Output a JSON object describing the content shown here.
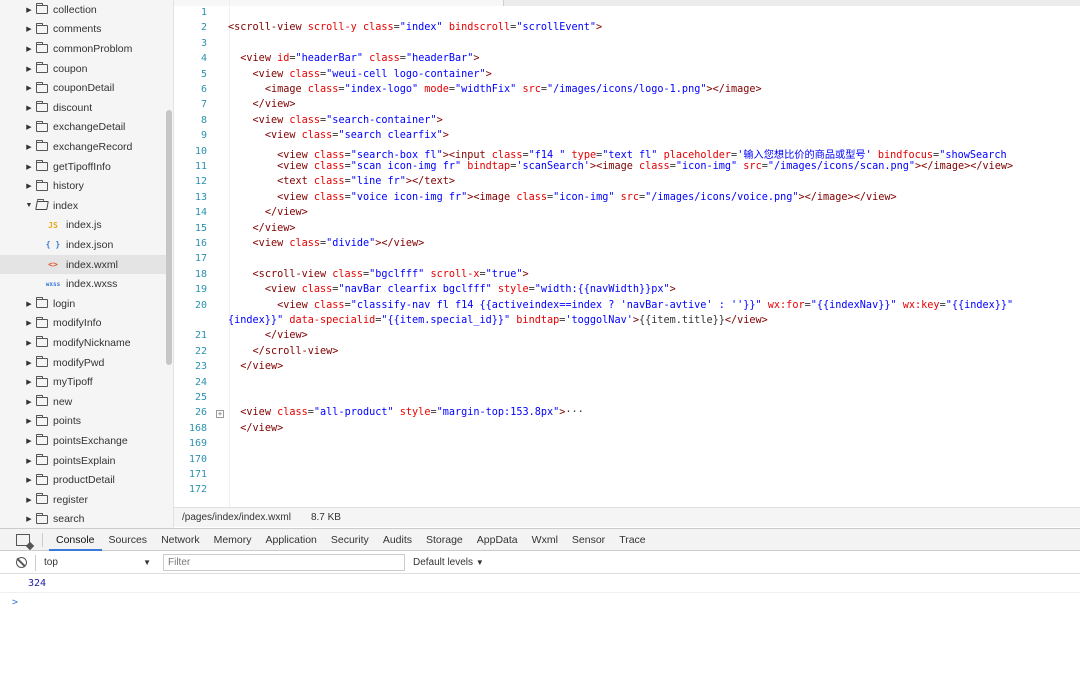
{
  "tree": {
    "items": [
      {
        "label": "collection",
        "type": "folder"
      },
      {
        "label": "comments",
        "type": "folder"
      },
      {
        "label": "commonProblom",
        "type": "folder"
      },
      {
        "label": "coupon",
        "type": "folder"
      },
      {
        "label": "couponDetail",
        "type": "folder"
      },
      {
        "label": "discount",
        "type": "folder"
      },
      {
        "label": "exchangeDetail",
        "type": "folder"
      },
      {
        "label": "exchangeRecord",
        "type": "folder"
      },
      {
        "label": "getTipoffInfo",
        "type": "folder"
      },
      {
        "label": "history",
        "type": "folder"
      },
      {
        "label": "index",
        "type": "folder-open"
      },
      {
        "label": "index.js",
        "type": "file",
        "badge": "JS",
        "badge_color": "#e6a817"
      },
      {
        "label": "index.json",
        "type": "file",
        "badge": "{ }",
        "badge_color": "#3b7bd4"
      },
      {
        "label": "index.wxml",
        "type": "file",
        "badge": "<>",
        "badge_color": "#e0532f",
        "selected": true
      },
      {
        "label": "index.wxss",
        "type": "file",
        "badge": "wxss",
        "badge_color": "#3b7bd4"
      },
      {
        "label": "login",
        "type": "folder"
      },
      {
        "label": "modifyInfo",
        "type": "folder"
      },
      {
        "label": "modifyNickname",
        "type": "folder"
      },
      {
        "label": "modifyPwd",
        "type": "folder"
      },
      {
        "label": "myTipoff",
        "type": "folder"
      },
      {
        "label": "new",
        "type": "folder"
      },
      {
        "label": "points",
        "type": "folder"
      },
      {
        "label": "pointsExchange",
        "type": "folder"
      },
      {
        "label": "pointsExplain",
        "type": "folder"
      },
      {
        "label": "productDetail",
        "type": "folder"
      },
      {
        "label": "register",
        "type": "folder"
      },
      {
        "label": "search",
        "type": "folder"
      }
    ]
  },
  "editor": {
    "lines": [
      {
        "num": "1",
        "tokens": []
      },
      {
        "num": "2",
        "tokens": [
          [
            "tag",
            "<scroll-view "
          ],
          [
            "attr",
            "scroll-y "
          ],
          [
            "attr",
            "class"
          ],
          [
            "pl",
            "="
          ],
          [
            "str",
            "\"index\" "
          ],
          [
            "attr",
            "bindscroll"
          ],
          [
            "pl",
            "="
          ],
          [
            "str",
            "\"scrollEvent\""
          ],
          [
            "tag",
            ">"
          ]
        ]
      },
      {
        "num": "3",
        "tokens": []
      },
      {
        "num": "4",
        "tokens": [
          [
            "pl",
            "  "
          ],
          [
            "tag",
            "<view "
          ],
          [
            "attr",
            "id"
          ],
          [
            "pl",
            "="
          ],
          [
            "str",
            "\"headerBar\" "
          ],
          [
            "attr",
            "class"
          ],
          [
            "pl",
            "="
          ],
          [
            "str",
            "\"headerBar\""
          ],
          [
            "tag",
            ">"
          ]
        ]
      },
      {
        "num": "5",
        "tokens": [
          [
            "pl",
            "    "
          ],
          [
            "tag",
            "<view "
          ],
          [
            "attr",
            "class"
          ],
          [
            "pl",
            "="
          ],
          [
            "str",
            "\"weui-cell logo-container\""
          ],
          [
            "tag",
            ">"
          ]
        ]
      },
      {
        "num": "6",
        "tokens": [
          [
            "pl",
            "      "
          ],
          [
            "tag",
            "<image "
          ],
          [
            "attr",
            "class"
          ],
          [
            "pl",
            "="
          ],
          [
            "str",
            "\"index-logo\" "
          ],
          [
            "attr",
            "mode"
          ],
          [
            "pl",
            "="
          ],
          [
            "str",
            "\"widthFix\" "
          ],
          [
            "attr",
            "src"
          ],
          [
            "pl",
            "="
          ],
          [
            "str",
            "\"/images/icons/logo-1.png\""
          ],
          [
            "tag",
            "></image>"
          ]
        ]
      },
      {
        "num": "7",
        "tokens": [
          [
            "pl",
            "    "
          ],
          [
            "tag",
            "</view>"
          ]
        ]
      },
      {
        "num": "8",
        "tokens": [
          [
            "pl",
            "    "
          ],
          [
            "tag",
            "<view "
          ],
          [
            "attr",
            "class"
          ],
          [
            "pl",
            "="
          ],
          [
            "str",
            "\"search-container\""
          ],
          [
            "tag",
            ">"
          ]
        ]
      },
      {
        "num": "9",
        "tokens": [
          [
            "pl",
            "      "
          ],
          [
            "tag",
            "<view "
          ],
          [
            "attr",
            "class"
          ],
          [
            "pl",
            "="
          ],
          [
            "str",
            "\"search clearfix\""
          ],
          [
            "tag",
            ">"
          ]
        ]
      },
      {
        "num": "10",
        "tokens": [
          [
            "pl",
            "        "
          ],
          [
            "tag",
            "<view "
          ],
          [
            "attr",
            "class"
          ],
          [
            "pl",
            "="
          ],
          [
            "str",
            "\"search-box fl\""
          ],
          [
            "tag",
            "><input "
          ],
          [
            "attr",
            "class"
          ],
          [
            "pl",
            "="
          ],
          [
            "str",
            "\"f14 \" "
          ],
          [
            "attr",
            "type"
          ],
          [
            "pl",
            "="
          ],
          [
            "str",
            "\"text fl\" "
          ],
          [
            "attr",
            "placeholder"
          ],
          [
            "pl",
            "="
          ],
          [
            "str",
            "'输入您想比价的商品或型号' "
          ],
          [
            "attr",
            "bindfocus"
          ],
          [
            "pl",
            "="
          ],
          [
            "str",
            "\"showSearch"
          ]
        ]
      },
      {
        "num": "11",
        "tokens": [
          [
            "pl",
            "        "
          ],
          [
            "tag",
            "<view "
          ],
          [
            "attr",
            "class"
          ],
          [
            "pl",
            "="
          ],
          [
            "str",
            "\"scan icon-img fr\" "
          ],
          [
            "attr",
            "bindtap"
          ],
          [
            "pl",
            "="
          ],
          [
            "str",
            "'scanSearch'"
          ],
          [
            "tag",
            "><image "
          ],
          [
            "attr",
            "class"
          ],
          [
            "pl",
            "="
          ],
          [
            "str",
            "\"icon-img\" "
          ],
          [
            "attr",
            "src"
          ],
          [
            "pl",
            "="
          ],
          [
            "str",
            "\"/images/icons/scan.png\""
          ],
          [
            "tag",
            "></image></view>"
          ]
        ]
      },
      {
        "num": "12",
        "tokens": [
          [
            "pl",
            "        "
          ],
          [
            "tag",
            "<text "
          ],
          [
            "attr",
            "class"
          ],
          [
            "pl",
            "="
          ],
          [
            "str",
            "\"line fr\""
          ],
          [
            "tag",
            "></text>"
          ]
        ]
      },
      {
        "num": "13",
        "tokens": [
          [
            "pl",
            "        "
          ],
          [
            "tag",
            "<view "
          ],
          [
            "attr",
            "class"
          ],
          [
            "pl",
            "="
          ],
          [
            "str",
            "\"voice icon-img fr\""
          ],
          [
            "tag",
            "><image "
          ],
          [
            "attr",
            "class"
          ],
          [
            "pl",
            "="
          ],
          [
            "str",
            "\"icon-img\" "
          ],
          [
            "attr",
            "src"
          ],
          [
            "pl",
            "="
          ],
          [
            "str",
            "\"/images/icons/voice.png\""
          ],
          [
            "tag",
            "></image></view>"
          ]
        ]
      },
      {
        "num": "14",
        "tokens": [
          [
            "pl",
            "      "
          ],
          [
            "tag",
            "</view>"
          ]
        ]
      },
      {
        "num": "15",
        "tokens": [
          [
            "pl",
            "    "
          ],
          [
            "tag",
            "</view>"
          ]
        ]
      },
      {
        "num": "16",
        "tokens": [
          [
            "pl",
            "    "
          ],
          [
            "tag",
            "<view "
          ],
          [
            "attr",
            "class"
          ],
          [
            "pl",
            "="
          ],
          [
            "str",
            "\"divide\""
          ],
          [
            "tag",
            "></view>"
          ]
        ]
      },
      {
        "num": "17",
        "tokens": []
      },
      {
        "num": "18",
        "tokens": [
          [
            "pl",
            "    "
          ],
          [
            "tag",
            "<scroll-view "
          ],
          [
            "attr",
            "class"
          ],
          [
            "pl",
            "="
          ],
          [
            "str",
            "\"bgclfff\" "
          ],
          [
            "attr",
            "scroll-x"
          ],
          [
            "pl",
            "="
          ],
          [
            "str",
            "\"true\""
          ],
          [
            "tag",
            ">"
          ]
        ]
      },
      {
        "num": "19",
        "tokens": [
          [
            "pl",
            "      "
          ],
          [
            "tag",
            "<view "
          ],
          [
            "attr",
            "class"
          ],
          [
            "pl",
            "="
          ],
          [
            "str",
            "\"navBar clearfix bgclfff\" "
          ],
          [
            "attr",
            "style"
          ],
          [
            "pl",
            "="
          ],
          [
            "str",
            "\"width:{{navWidth}}px\""
          ],
          [
            "tag",
            ">"
          ]
        ]
      },
      {
        "num": "20",
        "tokens": [
          [
            "pl",
            "        "
          ],
          [
            "tag",
            "<view "
          ],
          [
            "attr",
            "class"
          ],
          [
            "pl",
            "="
          ],
          [
            "str",
            "\"classify-nav fl f14 {{activeindex==index ? 'navBar-avtive' : ''}}\" "
          ],
          [
            "attr",
            "wx:for"
          ],
          [
            "pl",
            "="
          ],
          [
            "str",
            "\"{{indexNav}}\" "
          ],
          [
            "attr",
            "wx:key"
          ],
          [
            "pl",
            "="
          ],
          [
            "str",
            "\"{{index}}\""
          ]
        ]
      },
      {
        "num": "",
        "wrap": true,
        "tokens": [
          [
            "str",
            "{index}}\" "
          ],
          [
            "attr",
            "data-specialid"
          ],
          [
            "pl",
            "="
          ],
          [
            "str",
            "\"{{item.special_id}}\" "
          ],
          [
            "attr",
            "bindtap"
          ],
          [
            "pl",
            "="
          ],
          [
            "str",
            "'toggolNav'"
          ],
          [
            "tag",
            ">"
          ],
          [
            "pl",
            "{{item.title}}"
          ],
          [
            "tag",
            "</view>"
          ]
        ]
      },
      {
        "num": "21",
        "tokens": [
          [
            "pl",
            "      "
          ],
          [
            "tag",
            "</view>"
          ]
        ]
      },
      {
        "num": "22",
        "tokens": [
          [
            "pl",
            "    "
          ],
          [
            "tag",
            "</scroll-view>"
          ]
        ]
      },
      {
        "num": "23",
        "tokens": [
          [
            "pl",
            "  "
          ],
          [
            "tag",
            "</view>"
          ]
        ]
      },
      {
        "num": "24",
        "tokens": []
      },
      {
        "num": "25",
        "tokens": []
      },
      {
        "num": "26",
        "tokens": [
          [
            "pl",
            "  "
          ],
          [
            "tag",
            "<view "
          ],
          [
            "attr",
            "class"
          ],
          [
            "pl",
            "="
          ],
          [
            "str",
            "\"all-product\" "
          ],
          [
            "attr",
            "style"
          ],
          [
            "pl",
            "="
          ],
          [
            "str",
            "\"margin-top:153.8px\""
          ],
          [
            "tag",
            ">"
          ],
          [
            "pl",
            "···"
          ]
        ]
      },
      {
        "num": "168",
        "tokens": [
          [
            "pl",
            "  "
          ],
          [
            "tag",
            "</view>"
          ]
        ]
      },
      {
        "num": "169",
        "tokens": []
      },
      {
        "num": "170",
        "tokens": []
      },
      {
        "num": "171",
        "tokens": []
      },
      {
        "num": "172",
        "tokens": []
      }
    ]
  },
  "statusbar": {
    "path": "/pages/index/index.wxml",
    "size": "8.7 KB"
  },
  "devtools": {
    "tabs": [
      "Console",
      "Sources",
      "Network",
      "Memory",
      "Application",
      "Security",
      "Audits",
      "Storage",
      "AppData",
      "Wxml",
      "Sensor",
      "Trace"
    ],
    "active_tab": "Console",
    "context": "top",
    "filter_placeholder": "Filter",
    "levels": "Default levels",
    "log_value": "324",
    "prompt": ">"
  },
  "colors": {
    "tag": "#800000",
    "attr": "#e50000",
    "string": "#0000ff",
    "line_number": "#2b91af",
    "active_tab_underline": "#3879d9"
  }
}
